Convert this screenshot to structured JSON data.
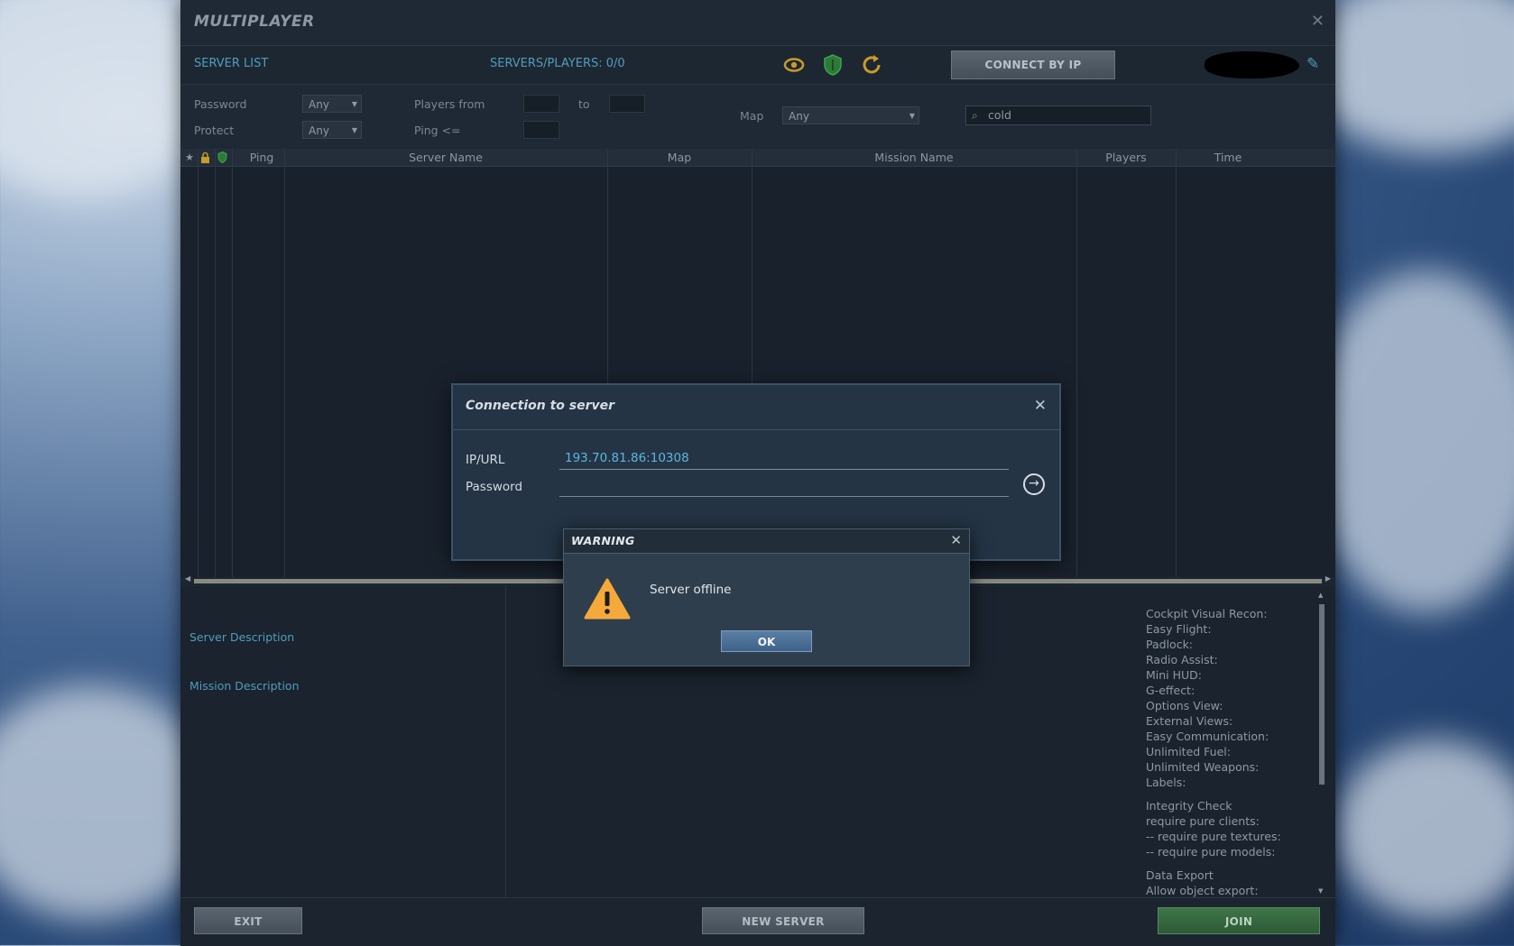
{
  "window": {
    "title": "MULTIPLAYER"
  },
  "toolbar": {
    "server_list_label": "SERVER LIST",
    "servers_players": "SERVERS/PLAYERS: 0/0",
    "connect_by_ip": "CONNECT BY IP",
    "icons": [
      "eye-icon",
      "shield-icon",
      "refresh-icon",
      "edit-icon"
    ]
  },
  "filters": {
    "password_label": "Password",
    "password_value": "Any",
    "protect_label": "Protect",
    "protect_value": "Any",
    "players_from_label": "Players from",
    "to_label": "to",
    "ping_label": "Ping <=",
    "map_label": "Map",
    "map_value": "Any",
    "search_value": "cold"
  },
  "table": {
    "columns": [
      "Ping",
      "Server Name",
      "Map",
      "Mission Name",
      "Players",
      "Time"
    ],
    "icon_columns": [
      "star-icon",
      "lock-icon",
      "shield-icon"
    ],
    "rows": []
  },
  "details": {
    "server_description_label": "Server Description",
    "mission_description_label": "Mission Description",
    "options": [
      "Cockpit Visual Recon:",
      "Easy Flight:",
      "Padlock:",
      "Radio Assist:",
      "Mini HUD:",
      "G-effect:",
      "Options View:",
      "External Views:",
      "Easy Communication:",
      "Unlimited Fuel:",
      "Unlimited Weapons:",
      "Labels:"
    ],
    "integrity": [
      "Integrity Check",
      "require pure clients:",
      "-- require pure textures:",
      "-- require pure models:"
    ],
    "data_export": [
      "Data Export",
      "Allow object export:"
    ]
  },
  "footer": {
    "exit": "EXIT",
    "new_server": "NEW SERVER",
    "join": "JOIN"
  },
  "connection_dialog": {
    "title": "Connection to server",
    "ip_label": "IP/URL",
    "ip_value": "193.70.81.86:10308",
    "password_label": "Password",
    "password_value": ""
  },
  "warning_dialog": {
    "title": "WARNING",
    "message": "Server offline",
    "ok": "OK"
  },
  "colors": {
    "accent": "#4f9dbb",
    "warning_icon": "#f5a93a",
    "join": "#3f7548"
  }
}
